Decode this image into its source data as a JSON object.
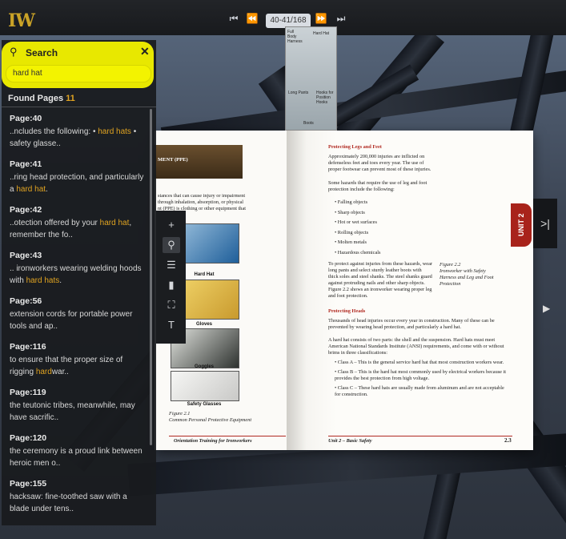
{
  "app": {
    "logo": "IW"
  },
  "viewer": {
    "nav": {
      "first": "⏮",
      "prev": "⏪",
      "next": "⏩",
      "last": "⏭"
    },
    "page_indicator": "40-41/168"
  },
  "search": {
    "title": "Search",
    "query": "hard hat",
    "found_label": "Found Pages",
    "found_count": "11",
    "results": [
      {
        "page": "Page:40",
        "pre": "..ncludes the following: • ",
        "hl": "hard hats",
        "post": " • safety glasse.."
      },
      {
        "page": "Page:41",
        "pre": "..ring head protection, and particularly a ",
        "hl": "hard hat",
        "post": "."
      },
      {
        "page": "Page:42",
        "pre": "..otection offered by your ",
        "hl": "hard hat",
        "post": ", remember the fo.."
      },
      {
        "page": "Page:43",
        "pre": ".. ironworkers wearing welding hoods with ",
        "hl": "hard hats",
        "post": "."
      },
      {
        "page": "Page:56",
        "pre": "extension cords for portable power tools and ap..",
        "hl": "",
        "post": ""
      },
      {
        "page": "Page:116",
        "pre": "to ensure that the proper size of rigging ",
        "hl": "hard",
        "post": "war.."
      },
      {
        "page": "Page:119",
        "pre": "the teutonic tribes, meanwhile, may have sacrific..",
        "hl": "",
        "post": ""
      },
      {
        "page": "Page:120",
        "pre": "the ceremony is a proud link between heroic men o..",
        "hl": "",
        "post": ""
      },
      {
        "page": "Page:155",
        "pre": "hacksaw: fine-toothed saw with a blade under tens..",
        "hl": "",
        "post": ""
      }
    ]
  },
  "tools": [
    {
      "name": "zoom-in-icon",
      "glyph": "+"
    },
    {
      "name": "search-icon",
      "glyph": "🔍"
    },
    {
      "name": "toc-icon",
      "glyph": "☰"
    },
    {
      "name": "bookmark-icon",
      "glyph": "🔖"
    },
    {
      "name": "fullscreen-icon",
      "glyph": "⛶"
    },
    {
      "name": "text-icon",
      "glyph": "T"
    }
  ],
  "book": {
    "left": {
      "header": "MENT (PPE)",
      "body": "stances that can cause injury or impairment through inhalation, absorption, or physical nt (PPE) is clothing or other equipment that",
      "captions": [
        "Hard Hat",
        "Gloves",
        "Goggles",
        "Safety Glasses"
      ],
      "figure": "Figure 2.1",
      "figure_caption": "Common Personal Protective Equipment",
      "footer": "Orientation Training for Ironworkers"
    },
    "right": {
      "h1": "Protecting Legs and Feet",
      "p1": "Approximately 200,000 injuries are inflicted on defenseless feet and toes every year. The use of proper footwear can prevent most of these injuries.",
      "p2": "Some hazards that require the use of leg and foot protection include the following:",
      "list1": [
        "Falling objects",
        "Sharp objects",
        "Hot or wet surfaces",
        "Rolling objects",
        "Molten metals",
        "Hazardous chemicals"
      ],
      "p3": "To protect against injuries from these hazards, wear long pants and select sturdy leather boots with thick soles and steel shanks. The steel shanks guard against protruding nails and other sharp objects. Figure 2.2 shows an ironworker wearing proper leg and foot protection.",
      "h2": "Protecting Heads",
      "p4": "Thousands of head injuries occur every year in construction. Many of these can be prevented by wearing head protection, and particularly a hard hat.",
      "p5": "A hard hat consists of two parts: the shell and the suspension. Hard hats must meet American National Standards Institute (ANSI) requirements, and come with or without brims in three classifications:",
      "list2": [
        "Class A – This is the general service hard hat that most construction workers wear.",
        "Class B – This is the hard hat most commonly used by electrical workers because it provides the best protection from high voltage.",
        "Class C – These hard hats are usually made from aluminum and are not acceptable for construction."
      ],
      "fig_labels": [
        "Full Body Harness",
        "Hard Hat",
        "Long Pants",
        "Hooks for Position Hooks",
        "Boots"
      ],
      "figure": "Figure 2.2",
      "figure_caption": "Ironworker with Safety Harness and Leg and Foot Protection",
      "footer_left": "Unit 2 – Basic Safety",
      "footer_right": "2.3",
      "unit_tab": "UNIT 2"
    }
  }
}
